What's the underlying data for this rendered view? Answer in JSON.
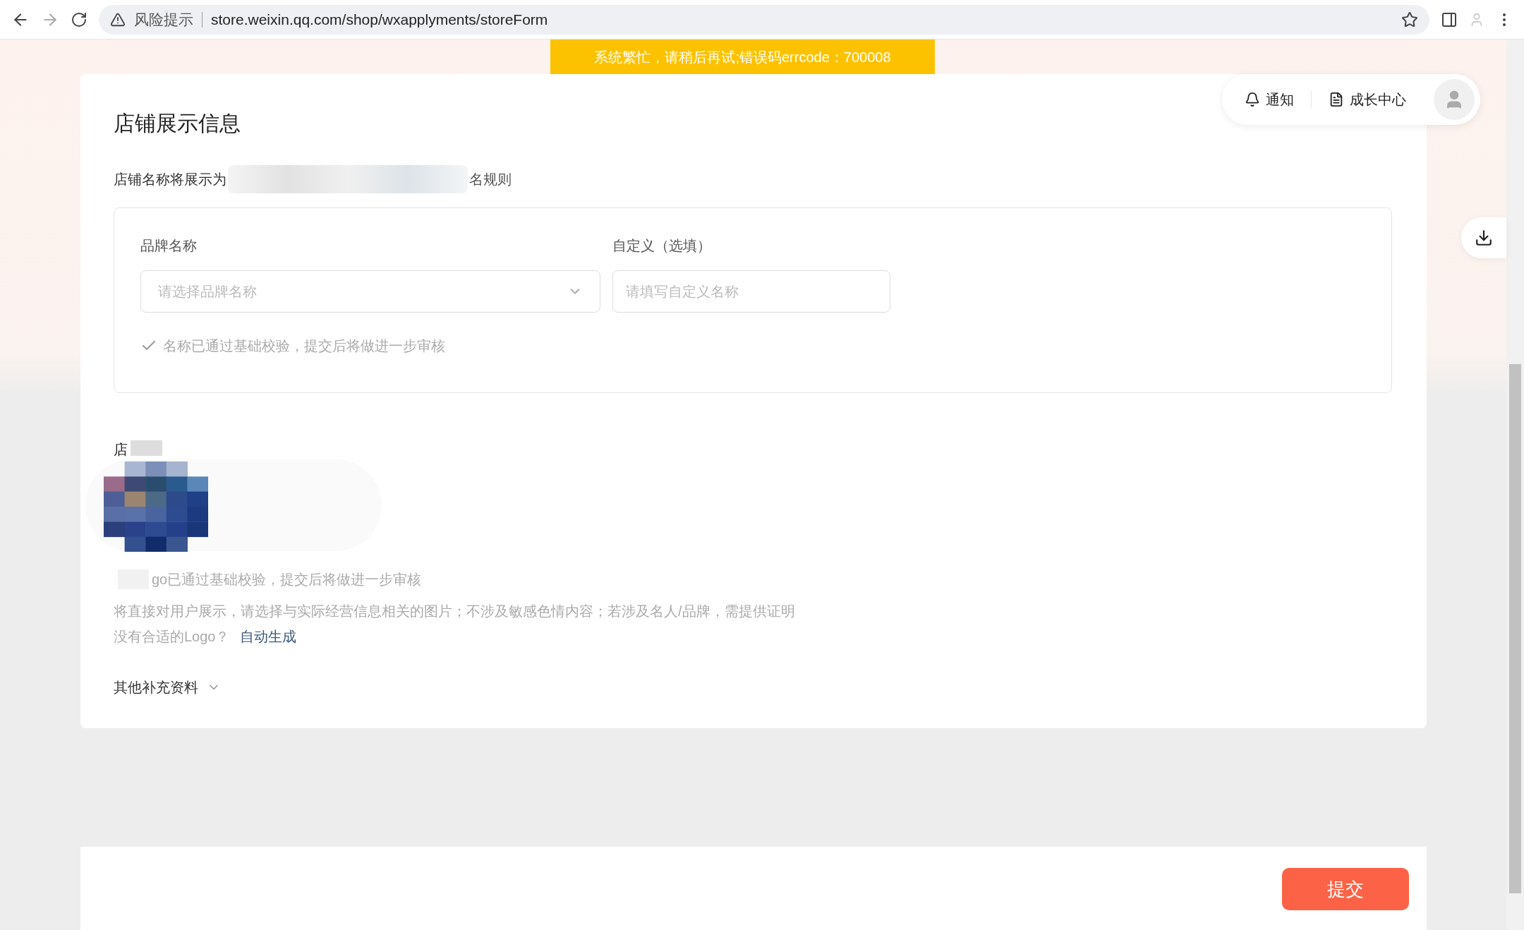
{
  "browser": {
    "security_label": "风险提示",
    "url": "store.weixin.qq.com/shop/wxapplyments/storeForm"
  },
  "banner": "系统繁忙，请稍后再试;错误码errcode：700008",
  "header": {
    "notification": "通知",
    "growth_center": "成长中心"
  },
  "section": {
    "title": "店铺展示信息",
    "name_preview_prefix": "店铺名称将展示为",
    "name_preview_suffix": "名规则",
    "fields": [
      {
        "kind": "select",
        "label": "品牌名称",
        "placeholder": "请选择品牌名称"
      },
      {
        "kind": "input",
        "label": "自定义（选填）",
        "placeholder": "请填写自定义名称"
      }
    ],
    "name_check": "名称已通过基础校验，提交后将做进一步审核",
    "logo_label": "店",
    "logo_check": "go已通过基础校验，提交后将做进一步审核",
    "logo_hint": "将直接对用户展示，请选择与实际经营信息相关的图片；不涉及敏感色情内容；若涉及名人/品牌，需提供证明",
    "logo_prompt": "没有合适的Logo？",
    "logo_link": "自动生成",
    "more": {
      "label": "其他补充资料",
      "expanded": false
    }
  },
  "submit": "提交"
}
